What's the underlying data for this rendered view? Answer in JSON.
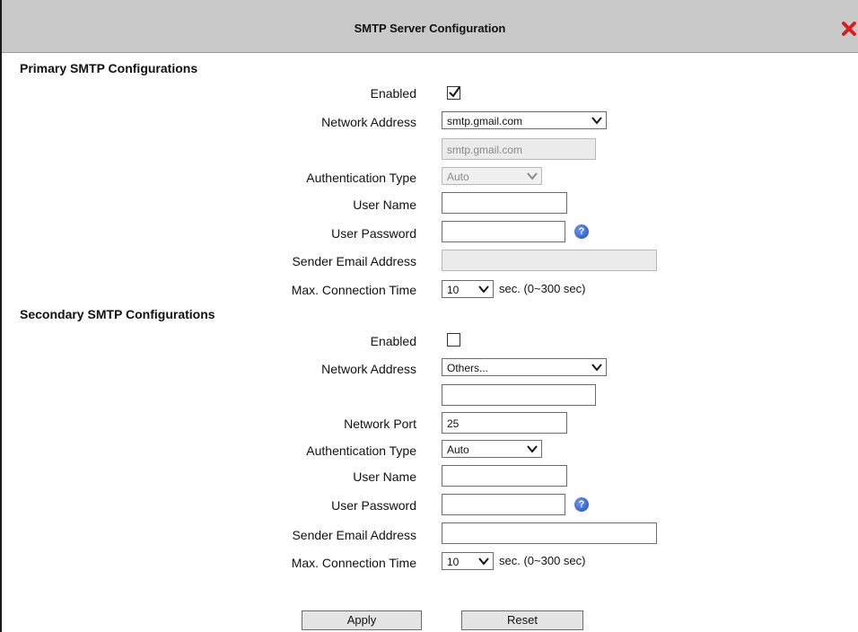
{
  "dialog": {
    "title": "SMTP Server Configuration",
    "close_icon": "close-icon"
  },
  "primary": {
    "section_title": "Primary SMTP Configurations",
    "enabled_label": "Enabled",
    "enabled": true,
    "network_address_label": "Network Address",
    "network_address_selected": "smtp.gmail.com",
    "network_address_value": "smtp.gmail.com",
    "auth_type_label": "Authentication Type",
    "auth_type_selected": "Auto",
    "user_name_label": "User Name",
    "user_name_value": "",
    "user_password_label": "User Password",
    "user_password_value": "",
    "sender_email_label": "Sender Email Address",
    "sender_email_value": "",
    "max_conn_label": "Max. Connection Time",
    "max_conn_selected": "10",
    "max_conn_unit": "sec. (0~300 sec)"
  },
  "secondary": {
    "section_title": "Secondary SMTP Configurations",
    "enabled_label": "Enabled",
    "enabled": false,
    "network_address_label": "Network Address",
    "network_address_selected": "Others...",
    "network_address_value": "",
    "network_port_label": "Network Port",
    "network_port_value": "25",
    "auth_type_label": "Authentication Type",
    "auth_type_selected": "Auto",
    "user_name_label": "User Name",
    "user_name_value": "",
    "user_password_label": "User Password",
    "user_password_value": "",
    "sender_email_label": "Sender Email Address",
    "sender_email_value": "",
    "max_conn_label": "Max. Connection Time",
    "max_conn_selected": "10",
    "max_conn_unit": "sec. (0~300 sec)"
  },
  "actions": {
    "apply_label": "Apply",
    "reset_label": "Reset"
  },
  "icons": {
    "help": "help-icon",
    "chevron": "chevron-down-icon",
    "check": "check-icon"
  },
  "colors": {
    "titlebar_bg": "#c9c9c9",
    "close_red": "#d42020",
    "help_blue": "#2a5bd7"
  }
}
